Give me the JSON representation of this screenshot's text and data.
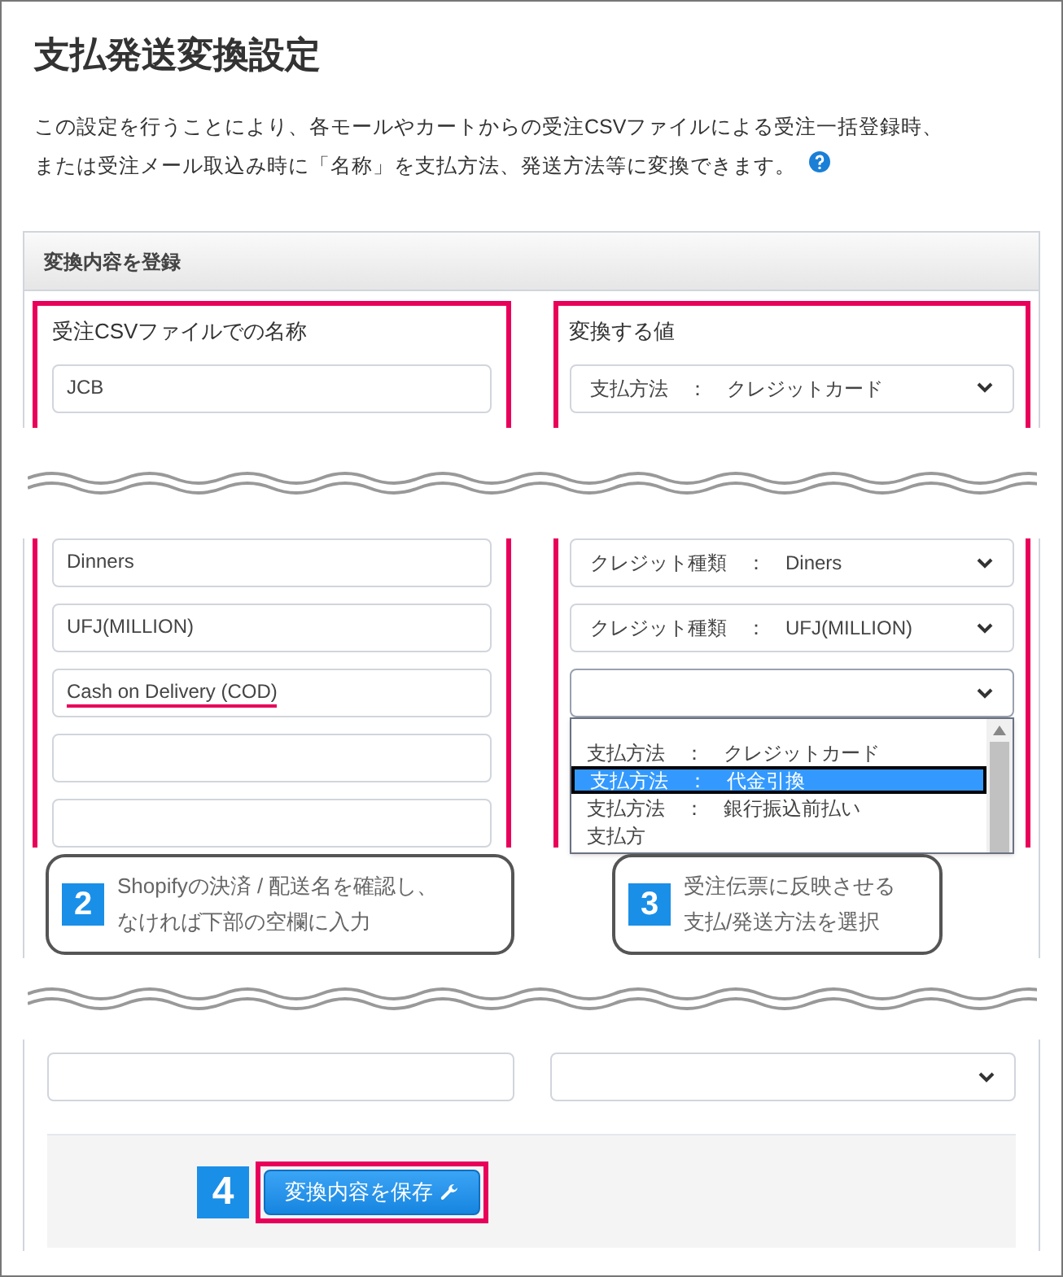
{
  "title": "支払発送変換設定",
  "description": [
    "この設定を行うことにより、各モールやカートからの受注CSVファイルによる受注一括登録時、",
    "または受注メール取込み時に「名称」を支払方法、発送方法等に変換できます。"
  ],
  "panel": {
    "header": "変換内容を登録",
    "left_label": "受注CSVファイルでの名称",
    "right_label": "変換する値"
  },
  "top_rows": [
    {
      "name": "JCB",
      "value": "支払方法　：　クレジットカード"
    }
  ],
  "middle_rows": [
    {
      "kind": "text",
      "name": "Dinners",
      "value": "クレジット種類　：　Diners",
      "highlighted": false
    },
    {
      "kind": "text",
      "name": "UFJ(MILLION)",
      "value": "クレジット種類　：　UFJ(MILLION)",
      "highlighted": false
    },
    {
      "kind": "text",
      "name": "Cash on Delivery (COD)",
      "highlighted": true,
      "open": true
    },
    {
      "kind": "blank"
    },
    {
      "kind": "blank"
    }
  ],
  "dropdown": {
    "options": [
      {
        "label": "支払方法　：　クレジットカード",
        "selected": false
      },
      {
        "label": "支払方法　：　代金引換",
        "selected": true
      },
      {
        "label": "支払方法　：　銀行振込前払い",
        "selected": false
      },
      {
        "label": "支払方",
        "selected": false
      }
    ]
  },
  "callouts": [
    {
      "number": "2",
      "lines": [
        "Shopifyの決済 / 配送名を確認し、",
        "なければ下部の空欄に入力"
      ]
    },
    {
      "number": "3",
      "lines": [
        "受注伝票に反映させる",
        "支払/発送方法を選択"
      ]
    }
  ],
  "save": {
    "number": "4",
    "label": "変換内容を保存"
  }
}
